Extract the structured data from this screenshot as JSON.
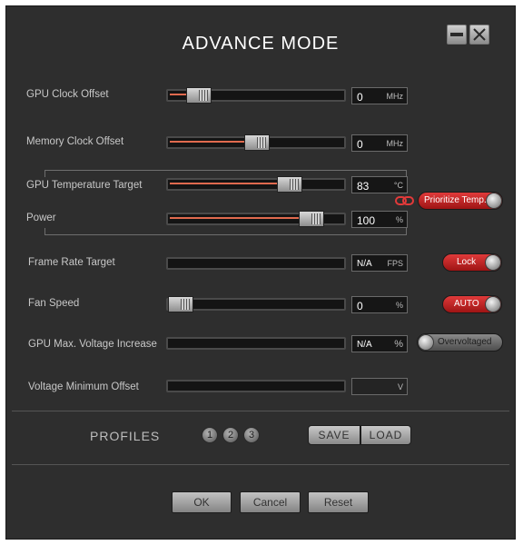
{
  "window": {
    "title": "ADVANCE MODE"
  },
  "rows": [
    {
      "label": "GPU Clock Offset",
      "value": "0",
      "unit": "MHz"
    },
    {
      "label": "Memory Clock Offset",
      "value": "0",
      "unit": "MHz"
    },
    {
      "label": "GPU Temperature Target",
      "value": "83",
      "unit": "°C"
    },
    {
      "label": "Power",
      "value": "100",
      "unit": "%"
    },
    {
      "label": "Frame Rate Target",
      "value": "N/A",
      "unit": "FPS"
    },
    {
      "label": "Fan Speed",
      "value": "0",
      "unit": "%"
    },
    {
      "label": "GPU Max. Voltage Increase",
      "value": "N/A",
      "unit": "%"
    },
    {
      "label": "Voltage Minimum Offset",
      "value": "",
      "unit": "V"
    }
  ],
  "toggles": {
    "prioritize": "Prioritize Temp.",
    "lock": "Lock",
    "auto": "AUTO",
    "overvoltaged": "Overvoltaged"
  },
  "profiles": {
    "label": "PROFILES",
    "numbers": [
      "1",
      "2",
      "3"
    ],
    "save": "SAVE",
    "load": "LOAD"
  },
  "footer": {
    "ok": "OK",
    "cancel": "Cancel",
    "reset": "Reset"
  },
  "icons": [
    "minimize-icon",
    "close-icon",
    "link-icon"
  ],
  "colors": {
    "accent": "#e06a4e",
    "toggle_red": "#c41f1f",
    "background": "#2e2e2e"
  }
}
